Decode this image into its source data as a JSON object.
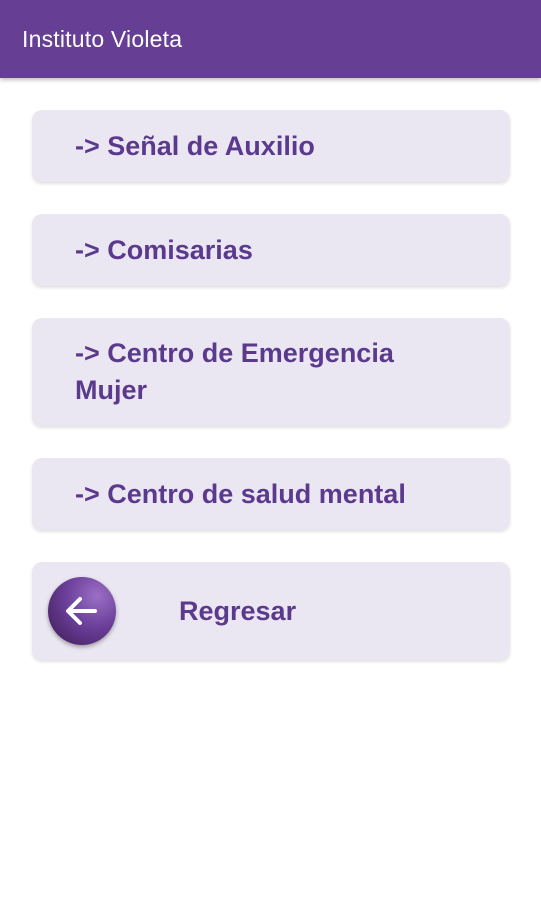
{
  "appbar": {
    "title": "Instituto Violeta",
    "color": "#663f95"
  },
  "menu": {
    "items": [
      {
        "label": "-> Señal de Auxilio"
      },
      {
        "label": "-> Comisarias"
      },
      {
        "label": "-> Centro de Emergencia Mujer"
      },
      {
        "label": "-> Centro de salud mental"
      }
    ]
  },
  "back": {
    "label": "Regresar",
    "icon": "arrow-left-icon"
  },
  "colors": {
    "button_bg": "#ebe7f2",
    "button_text": "#5b3a8e"
  }
}
